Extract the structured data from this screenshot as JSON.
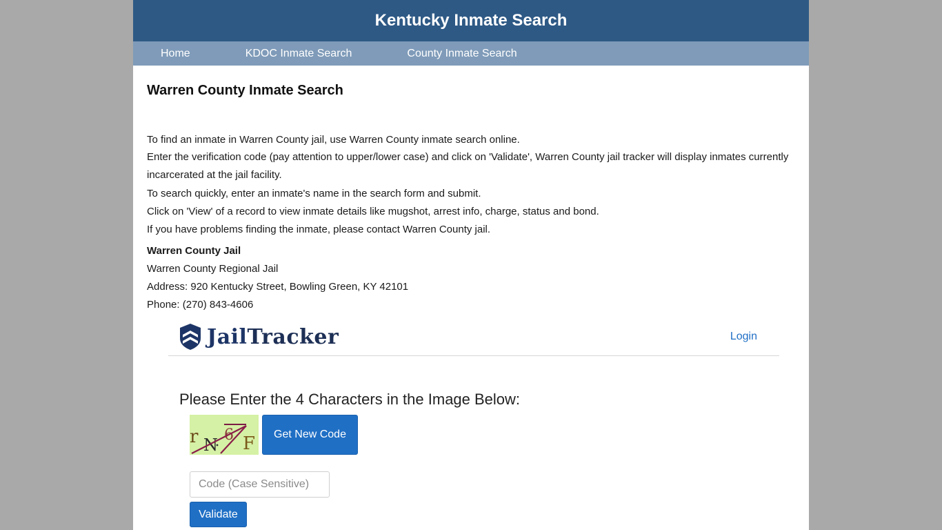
{
  "header": {
    "title": "Kentucky Inmate Search"
  },
  "nav": {
    "items": [
      {
        "label": "Home"
      },
      {
        "label": "KDOC Inmate Search"
      },
      {
        "label": "County Inmate Search"
      }
    ]
  },
  "main": {
    "title": "Warren County Inmate Search",
    "paragraphs": [
      "To find an inmate in Warren County jail, use Warren County inmate search online.",
      "Enter the verification code (pay attention to upper/lower case) and click on 'Validate', Warren County jail tracker will display inmates currently incarcerated at the jail facility.",
      "To search quickly, enter an inmate's name in the search form and submit.",
      "Click on 'View' of a record to view inmate details like mugshot, arrest info, charge, status and bond.",
      "If you have problems finding the inmate, please contact Warren County jail."
    ],
    "jail": {
      "heading": "Warren County Jail",
      "name": "Warren County Regional Jail",
      "address": "Address: 920 Kentucky Street, Bowling Green, KY 42101",
      "phone": "Phone: (270) 843-4606"
    }
  },
  "jailtracker": {
    "brand_jail": "Jail",
    "brand_tracker": "Tracker",
    "logo_icon": "shield-icon",
    "login_label": "Login",
    "prompt": "Please Enter the 4 Characters in the Image Below:",
    "captcha_chars": [
      "r",
      "N",
      "6",
      "F"
    ],
    "new_code_label": "Get New Code",
    "code_placeholder": "Code (Case Sensitive)",
    "code_value": "",
    "validate_label": "Validate"
  },
  "colors": {
    "header_bg": "#2e5985",
    "nav_bg": "#7f9bb9",
    "button_blue": "#1f6fc5",
    "page_bg": "#a9a9a9",
    "captcha_bg": "#d5f1a5"
  }
}
